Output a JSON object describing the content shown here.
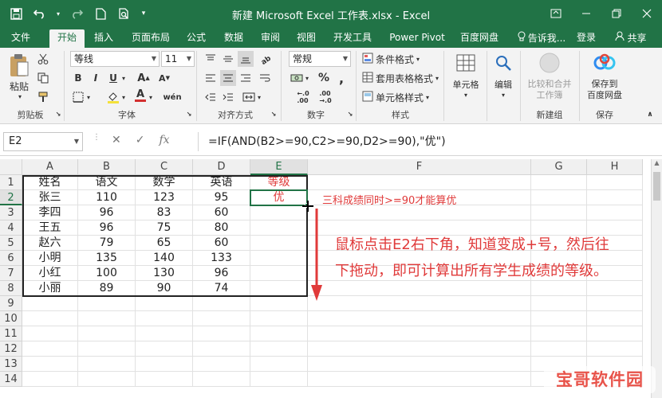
{
  "window": {
    "title": "新建 Microsoft Excel 工作表.xlsx - Excel"
  },
  "tabs": [
    {
      "label": "文件",
      "active": false
    },
    {
      "label": "开始",
      "active": true
    },
    {
      "label": "插入",
      "active": false
    },
    {
      "label": "页面布局",
      "active": false
    },
    {
      "label": "公式",
      "active": false
    },
    {
      "label": "数据",
      "active": false
    },
    {
      "label": "审阅",
      "active": false
    },
    {
      "label": "视图",
      "active": false
    },
    {
      "label": "开发工具",
      "active": false
    },
    {
      "label": "Power Pivot",
      "active": false
    },
    {
      "label": "百度网盘",
      "active": false
    }
  ],
  "tell_me": "告诉我...",
  "login": "登录",
  "share": "共享",
  "ribbon": {
    "clipboard": {
      "paste": "粘贴",
      "label": "剪贴板"
    },
    "font": {
      "name": "等线",
      "size": "11",
      "label": "字体"
    },
    "alignment": {
      "label": "对齐方式"
    },
    "number": {
      "format": "常规",
      "label": "数字"
    },
    "styles": {
      "conditional": "条件格式",
      "table": "套用表格格式",
      "cell": "单元格样式",
      "label": "样式"
    },
    "cells": {
      "label": "单元格"
    },
    "editing": {
      "label": "编辑"
    },
    "compare": {
      "line1": "比较和合并",
      "line2": "工作簿",
      "label": "新建组"
    },
    "save": {
      "line1": "保存到",
      "line2": "百度网盘",
      "label": "保存"
    }
  },
  "formula_bar": {
    "name_box": "E2",
    "fx": "fx",
    "formula": "=IF(AND(B2>=90,C2>=90,D2>=90),\"优\")"
  },
  "columns": [
    "A",
    "B",
    "C",
    "D",
    "E",
    "F",
    "G",
    "H"
  ],
  "rows": [
    "1",
    "2",
    "3",
    "4",
    "5",
    "6",
    "7",
    "8",
    "9",
    "10",
    "11",
    "12",
    "13",
    "14"
  ],
  "sheet": {
    "header": [
      "姓名",
      "语文",
      "数学",
      "英语",
      "等级"
    ],
    "data": [
      [
        "张三",
        "110",
        "123",
        "95",
        "优"
      ],
      [
        "李四",
        "96",
        "83",
        "60",
        ""
      ],
      [
        "王五",
        "96",
        "75",
        "80",
        ""
      ],
      [
        "赵六",
        "79",
        "65",
        "60",
        ""
      ],
      [
        "小明",
        "135",
        "140",
        "133",
        ""
      ],
      [
        "小红",
        "100",
        "130",
        "96",
        ""
      ],
      [
        "小丽",
        "89",
        "90",
        "74",
        ""
      ]
    ]
  },
  "annotations": {
    "note1": "三科成绩同时>=90才能算优",
    "note2_line1": "鼠标点击E2右下角，知道变成+号，然后往",
    "note2_line2": "下拖动，即可计算出所有学生成绩的等级。"
  },
  "watermark": "宝哥软件园",
  "colors": {
    "excel_green": "#217346",
    "annotation_red": "#e03a3a"
  }
}
